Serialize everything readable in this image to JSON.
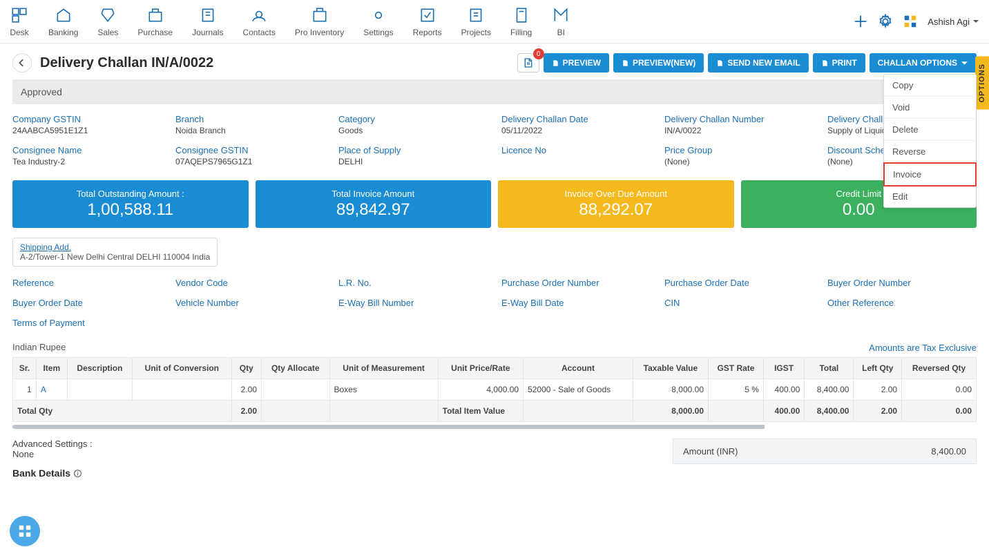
{
  "nav": [
    "Desk",
    "Banking",
    "Sales",
    "Purchase",
    "Journals",
    "Contacts",
    "Pro Inventory",
    "Settings",
    "Reports",
    "Projects",
    "Filling",
    "BI"
  ],
  "user": "Ashish Agi",
  "title": "Delivery Challan IN/A/0022",
  "badge": "0",
  "actions": {
    "preview": "PREVIEW",
    "previewnew": "PREVIEW(NEW)",
    "send": "SEND NEW EMAIL",
    "print": "PRINT",
    "opts": "CHALLAN OPTIONS"
  },
  "status": "Approved",
  "meta": [
    {
      "l": "Company GSTIN",
      "v": "24AABCA5951E1Z1"
    },
    {
      "l": "Branch",
      "v": "Noida Branch"
    },
    {
      "l": "Category",
      "v": "Goods"
    },
    {
      "l": "Delivery Challan Date",
      "v": "05/11/2022"
    },
    {
      "l": "Delivery Challan Number",
      "v": "IN/A/0022"
    },
    {
      "l": "Delivery Challa",
      "v": "Supply of Liquid"
    },
    {
      "l": "Consignee Name",
      "v": "Tea Industry-2"
    },
    {
      "l": "Consignee GSTIN",
      "v": "07AQEPS7965G1Z1"
    },
    {
      "l": "Place of Supply",
      "v": "DELHI"
    },
    {
      "l": "Licence No",
      "v": ""
    },
    {
      "l": "Price Group",
      "v": "(None)"
    },
    {
      "l": "Discount Sche",
      "v": "(None)"
    }
  ],
  "kpis": [
    {
      "t": "Total Outstanding Amount :",
      "v": "1,00,588.11",
      "c": "blue"
    },
    {
      "t": "Total Invoice Amount",
      "v": "89,842.97",
      "c": "blue"
    },
    {
      "t": "Invoice Over Due Amount",
      "v": "88,292.07",
      "c": "yellow"
    },
    {
      "t": "Credit Limit",
      "v": "0.00",
      "c": "green"
    }
  ],
  "ship": {
    "l": "Shipping Add.",
    "v": "A-2/Tower-1 New Delhi Central DELHI 110004 India"
  },
  "refs": [
    "Reference",
    "Vendor Code",
    "L.R. No.",
    "Purchase Order Number",
    "Purchase Order Date",
    "Buyer Order Number",
    "Buyer Order Date",
    "Vehicle Number",
    "E-Way Bill Number",
    "E-Way Bill Date",
    "CIN",
    "Other Reference",
    "Terms of Payment"
  ],
  "currency": "Indian Rupee",
  "taxnote": "Amounts are Tax Exclusive",
  "cols": [
    "Sr.",
    "Item",
    "Description",
    "Unit of Conversion",
    "Qty",
    "Qty Allocate",
    "Unit of Measurement",
    "Unit Price/Rate",
    "Account",
    "Taxable Value",
    "GST Rate",
    "IGST",
    "Total",
    "Left Qty",
    "Reversed Qty"
  ],
  "row": {
    "sr": "1",
    "item": "A",
    "desc": "",
    "uoc": "",
    "qty": "2.00",
    "qa": "",
    "uom": "Boxes",
    "rate": "4,000.00",
    "acc": "52000 - Sale of Goods",
    "tax": "8,000.00",
    "gst": "5 %",
    "igst": "400.00",
    "total": "8,400.00",
    "left": "2.00",
    "rev": "0.00"
  },
  "foot": {
    "lbl": "Total Qty",
    "qty": "2.00",
    "tiv": "Total Item Value",
    "tax": "8,000.00",
    "igst": "400.00",
    "total": "8,400.00",
    "left": "2.00",
    "rev": "0.00"
  },
  "adv": {
    "l": "Advanced Settings :",
    "v": "None"
  },
  "bank": "Bank Details",
  "amount": {
    "l": "Amount (INR)",
    "v": "8,400.00"
  },
  "options_tab": "OPTIONS",
  "dropdown": [
    "Copy",
    "Void",
    "Delete",
    "Reverse",
    "Invoice",
    "Edit"
  ]
}
